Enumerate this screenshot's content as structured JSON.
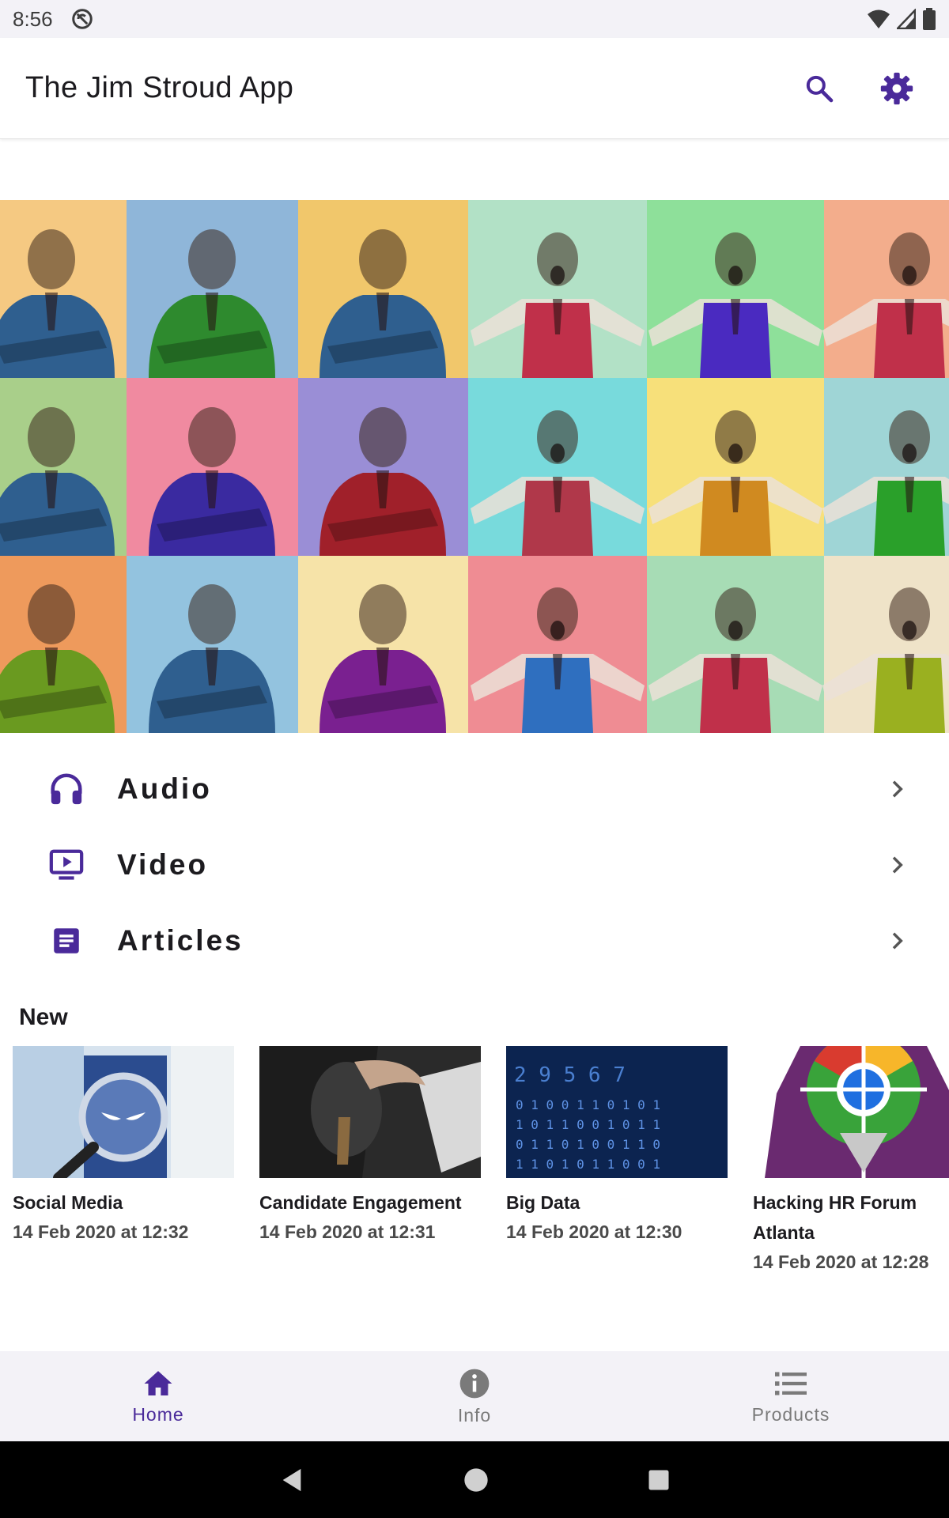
{
  "status_bar": {
    "time": "8:56"
  },
  "app_bar": {
    "title": "The Jim Stroud App",
    "search_icon": "search-icon",
    "settings_icon": "gear-icon"
  },
  "colors": {
    "accent": "#4a2a9a",
    "nav_background": "#f3f2f7",
    "inactive": "#7a7a7a"
  },
  "menu": {
    "items": [
      {
        "label": "Audio",
        "icon": "headphones-icon"
      },
      {
        "label": "Video",
        "icon": "video-icon"
      },
      {
        "label": "Articles",
        "icon": "article-icon"
      }
    ]
  },
  "new_section": {
    "heading": "New",
    "cards": [
      {
        "title": "Social Media",
        "date": "14 Feb 2020 at 12:32"
      },
      {
        "title": "Candidate Engagement",
        "date": "14 Feb 2020 at 12:31"
      },
      {
        "title": "Big Data",
        "date": "14 Feb 2020 at 12:30"
      },
      {
        "title": "Hacking HR Forum Atlanta",
        "date": "14 Feb 2020 at 12:28"
      }
    ]
  },
  "bottom_nav": {
    "items": [
      {
        "label": "Home",
        "icon": "home-icon",
        "selected": true
      },
      {
        "label": "Info",
        "icon": "info-icon",
        "selected": false
      },
      {
        "label": "Products",
        "icon": "list-icon",
        "selected": false
      }
    ]
  }
}
